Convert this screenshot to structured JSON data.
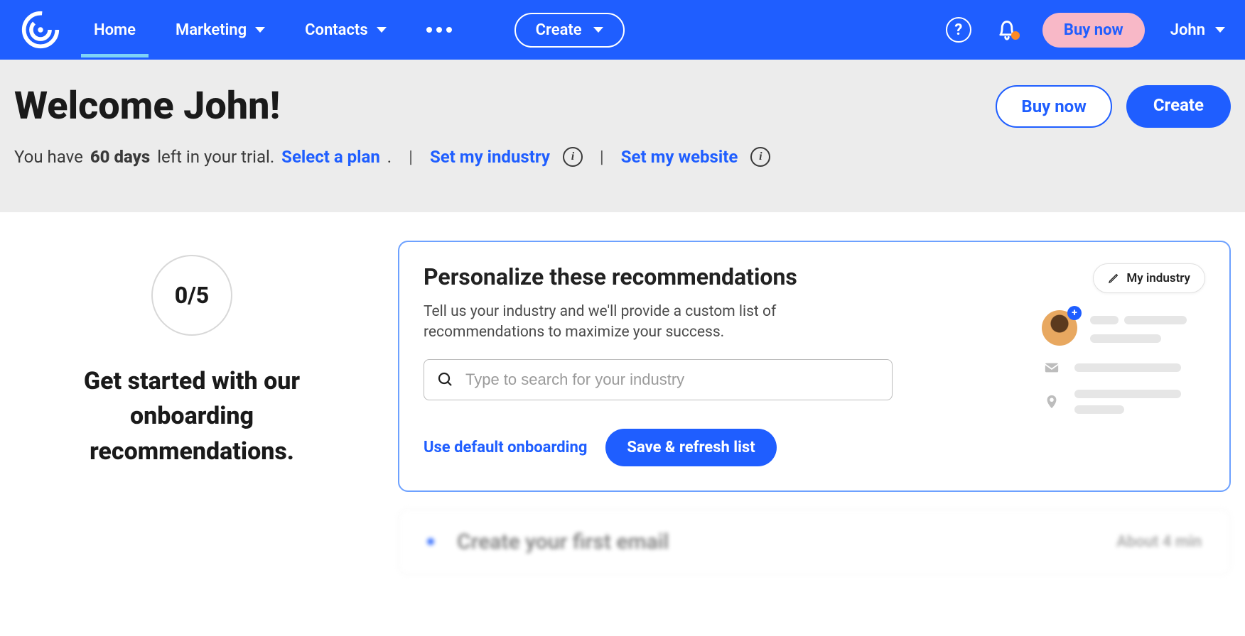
{
  "nav": {
    "home": "Home",
    "marketing": "Marketing",
    "contacts": "Contacts",
    "create": "Create",
    "buy": "Buy now",
    "user": "John"
  },
  "hero": {
    "welcome": "Welcome John!",
    "trial_prefix": "You have ",
    "trial_days": "60 days",
    "trial_suffix": " left in your trial. ",
    "select_plan": "Select a plan",
    "period": ".",
    "set_industry": "Set my industry",
    "set_website": "Set my website",
    "buy": "Buy now",
    "create": "Create"
  },
  "progress": {
    "value": "0/5",
    "heading_l1": "Get started with our",
    "heading_l2": "onboarding",
    "heading_l3": "recommendations."
  },
  "card": {
    "title": "Personalize these recommendations",
    "desc": "Tell us your industry and we'll provide a custom list of recommendations to maximize your success.",
    "placeholder": "Type to search for your industry",
    "use_default": "Use default onboarding",
    "save": "Save & refresh list",
    "my_industry": "My industry"
  },
  "next": {
    "title": "Create your first email",
    "duration": "About 4 min"
  }
}
